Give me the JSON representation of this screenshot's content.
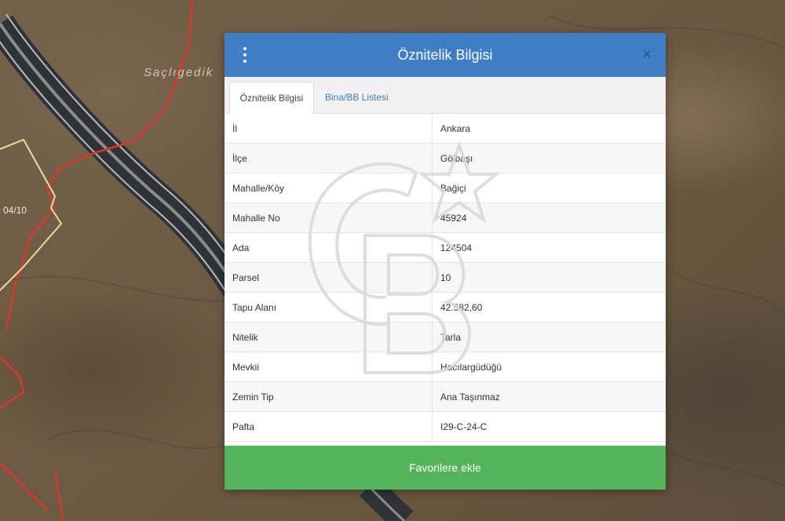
{
  "map": {
    "place_label": "Saçlıgedik",
    "parcel_label": "04/10"
  },
  "dialog": {
    "title": "Öznitelik Bilgisi",
    "menu_icon": "vertical-dots-icon",
    "close_icon": "close-icon",
    "close_symbol": "×",
    "tabs": [
      {
        "label": "Öznitelik Bilgisi",
        "active": true
      },
      {
        "label": "Bina/BB Listesi",
        "active": false
      }
    ],
    "rows": [
      {
        "label": "İl",
        "value": "Ankara"
      },
      {
        "label": "İlçe",
        "value": "Gölbaşı"
      },
      {
        "label": "Mahalle/Köy",
        "value": "Bağiçi"
      },
      {
        "label": "Mahalle No",
        "value": "45924"
      },
      {
        "label": "Ada",
        "value": "124504"
      },
      {
        "label": "Parsel",
        "value": "10"
      },
      {
        "label": "Tapu Alanı",
        "value": "42.582,60"
      },
      {
        "label": "Nitelik",
        "value": "Tarla"
      },
      {
        "label": "Mevkii",
        "value": "Hacılargüdüğü"
      },
      {
        "label": "Zemin Tip",
        "value": "Ana Taşınmaz"
      },
      {
        "label": "Pafta",
        "value": "I29-C-24-C"
      }
    ],
    "favorite_button": "Favorilere ekle"
  },
  "colors": {
    "header": "#3d7fc2",
    "tab_link": "#3d7fc2",
    "favorite_button": "#54b35b",
    "parcel_boundary": "#d8382a",
    "parcel_outline": "#e6df9c"
  },
  "watermark": "CB logo with star"
}
